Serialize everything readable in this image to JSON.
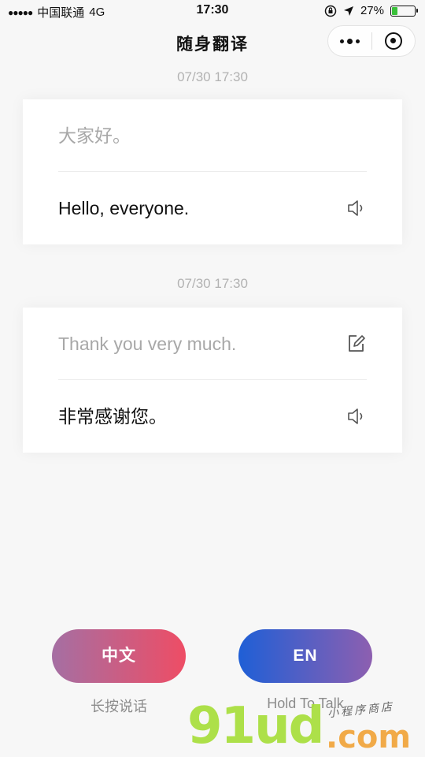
{
  "status_bar": {
    "signal": "●●●●●",
    "carrier": "中国联通",
    "network": "4G",
    "time": "17:30",
    "battery_percent": "27%",
    "battery_level": 0.27
  },
  "nav": {
    "title": "随身翻译"
  },
  "conversations": [
    {
      "timestamp": "07/30 17:30",
      "source_text": "大家好。",
      "translated_text": "Hello, everyone."
    },
    {
      "timestamp": "07/30 17:30",
      "source_text": "Thank you very much.",
      "translated_text": "非常感谢您。"
    }
  ],
  "buttons": {
    "chinese": {
      "label": "中文",
      "hint": "长按说话"
    },
    "english": {
      "label": "EN",
      "hint": "Hold To Talk"
    }
  },
  "watermark": {
    "logo_text": "91ud",
    "domain_suffix": ".com",
    "tagline": "小程序商店"
  },
  "colors": {
    "cn_button_start": "#a56fa3",
    "cn_button_end": "#ee4d65",
    "en_button_start": "#1f5fd6",
    "en_button_end": "#8d5fb0",
    "battery": "#3ac13a"
  },
  "icons": {
    "speaker": "speaker-icon",
    "edit": "edit-icon",
    "location": "location-arrow-icon",
    "lock": "rotation-lock-icon"
  }
}
